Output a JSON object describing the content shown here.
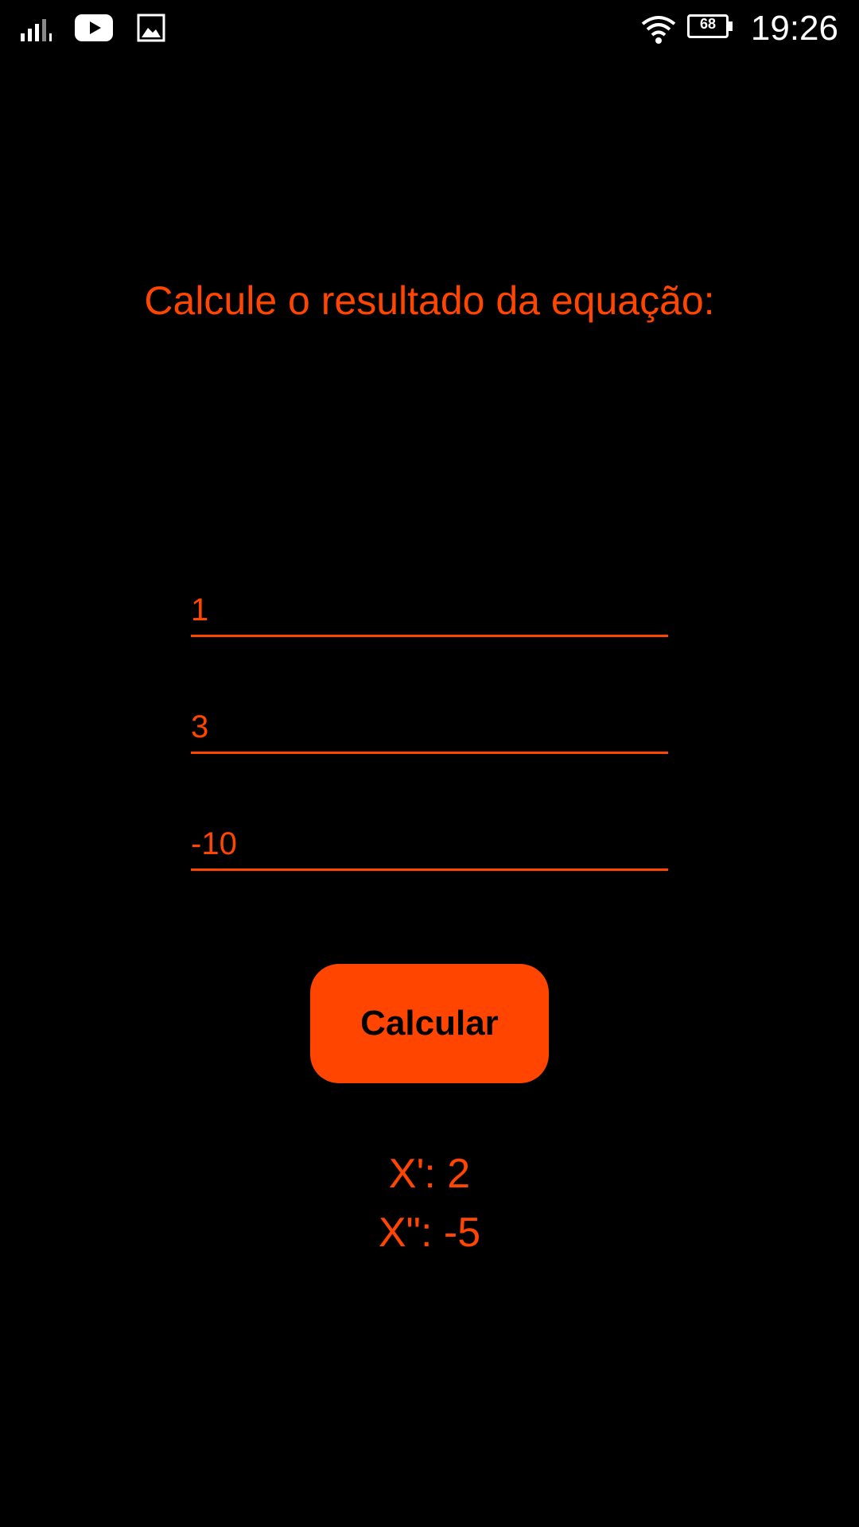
{
  "status_bar": {
    "time": "19:26",
    "battery_level": "68",
    "icons": [
      "signal-icon",
      "youtube-icon",
      "gallery-icon",
      "wifi-icon",
      "battery-icon"
    ]
  },
  "main": {
    "title": "Calcule o resultado da equação:",
    "inputs": [
      {
        "value": "1"
      },
      {
        "value": "3"
      },
      {
        "value": "-10"
      }
    ],
    "button_label": "Calcular",
    "results": {
      "x1": "X': 2",
      "x2": "X\": -5"
    }
  },
  "colors": {
    "background": "#000000",
    "accent": "#FF4500",
    "button_text": "#000000",
    "status_icons": "#FFFFFF"
  }
}
